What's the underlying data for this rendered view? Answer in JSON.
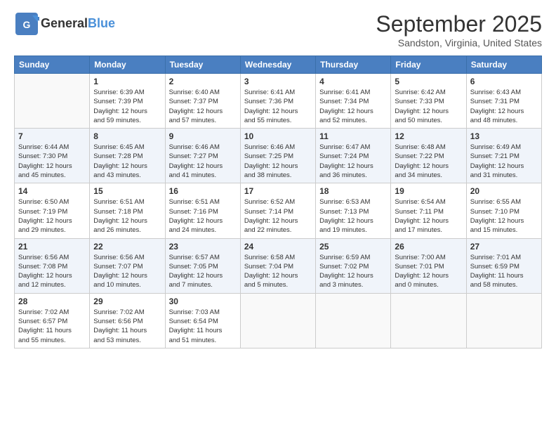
{
  "logo": {
    "general": "General",
    "blue": "Blue"
  },
  "header": {
    "month": "September 2025",
    "location": "Sandston, Virginia, United States"
  },
  "weekdays": [
    "Sunday",
    "Monday",
    "Tuesday",
    "Wednesday",
    "Thursday",
    "Friday",
    "Saturday"
  ],
  "weeks": [
    [
      {
        "day": "",
        "info": ""
      },
      {
        "day": "1",
        "info": "Sunrise: 6:39 AM\nSunset: 7:39 PM\nDaylight: 12 hours\nand 59 minutes."
      },
      {
        "day": "2",
        "info": "Sunrise: 6:40 AM\nSunset: 7:37 PM\nDaylight: 12 hours\nand 57 minutes."
      },
      {
        "day": "3",
        "info": "Sunrise: 6:41 AM\nSunset: 7:36 PM\nDaylight: 12 hours\nand 55 minutes."
      },
      {
        "day": "4",
        "info": "Sunrise: 6:41 AM\nSunset: 7:34 PM\nDaylight: 12 hours\nand 52 minutes."
      },
      {
        "day": "5",
        "info": "Sunrise: 6:42 AM\nSunset: 7:33 PM\nDaylight: 12 hours\nand 50 minutes."
      },
      {
        "day": "6",
        "info": "Sunrise: 6:43 AM\nSunset: 7:31 PM\nDaylight: 12 hours\nand 48 minutes."
      }
    ],
    [
      {
        "day": "7",
        "info": "Sunrise: 6:44 AM\nSunset: 7:30 PM\nDaylight: 12 hours\nand 45 minutes."
      },
      {
        "day": "8",
        "info": "Sunrise: 6:45 AM\nSunset: 7:28 PM\nDaylight: 12 hours\nand 43 minutes."
      },
      {
        "day": "9",
        "info": "Sunrise: 6:46 AM\nSunset: 7:27 PM\nDaylight: 12 hours\nand 41 minutes."
      },
      {
        "day": "10",
        "info": "Sunrise: 6:46 AM\nSunset: 7:25 PM\nDaylight: 12 hours\nand 38 minutes."
      },
      {
        "day": "11",
        "info": "Sunrise: 6:47 AM\nSunset: 7:24 PM\nDaylight: 12 hours\nand 36 minutes."
      },
      {
        "day": "12",
        "info": "Sunrise: 6:48 AM\nSunset: 7:22 PM\nDaylight: 12 hours\nand 34 minutes."
      },
      {
        "day": "13",
        "info": "Sunrise: 6:49 AM\nSunset: 7:21 PM\nDaylight: 12 hours\nand 31 minutes."
      }
    ],
    [
      {
        "day": "14",
        "info": "Sunrise: 6:50 AM\nSunset: 7:19 PM\nDaylight: 12 hours\nand 29 minutes."
      },
      {
        "day": "15",
        "info": "Sunrise: 6:51 AM\nSunset: 7:18 PM\nDaylight: 12 hours\nand 26 minutes."
      },
      {
        "day": "16",
        "info": "Sunrise: 6:51 AM\nSunset: 7:16 PM\nDaylight: 12 hours\nand 24 minutes."
      },
      {
        "day": "17",
        "info": "Sunrise: 6:52 AM\nSunset: 7:14 PM\nDaylight: 12 hours\nand 22 minutes."
      },
      {
        "day": "18",
        "info": "Sunrise: 6:53 AM\nSunset: 7:13 PM\nDaylight: 12 hours\nand 19 minutes."
      },
      {
        "day": "19",
        "info": "Sunrise: 6:54 AM\nSunset: 7:11 PM\nDaylight: 12 hours\nand 17 minutes."
      },
      {
        "day": "20",
        "info": "Sunrise: 6:55 AM\nSunset: 7:10 PM\nDaylight: 12 hours\nand 15 minutes."
      }
    ],
    [
      {
        "day": "21",
        "info": "Sunrise: 6:56 AM\nSunset: 7:08 PM\nDaylight: 12 hours\nand 12 minutes."
      },
      {
        "day": "22",
        "info": "Sunrise: 6:56 AM\nSunset: 7:07 PM\nDaylight: 12 hours\nand 10 minutes."
      },
      {
        "day": "23",
        "info": "Sunrise: 6:57 AM\nSunset: 7:05 PM\nDaylight: 12 hours\nand 7 minutes."
      },
      {
        "day": "24",
        "info": "Sunrise: 6:58 AM\nSunset: 7:04 PM\nDaylight: 12 hours\nand 5 minutes."
      },
      {
        "day": "25",
        "info": "Sunrise: 6:59 AM\nSunset: 7:02 PM\nDaylight: 12 hours\nand 3 minutes."
      },
      {
        "day": "26",
        "info": "Sunrise: 7:00 AM\nSunset: 7:01 PM\nDaylight: 12 hours\nand 0 minutes."
      },
      {
        "day": "27",
        "info": "Sunrise: 7:01 AM\nSunset: 6:59 PM\nDaylight: 11 hours\nand 58 minutes."
      }
    ],
    [
      {
        "day": "28",
        "info": "Sunrise: 7:02 AM\nSunset: 6:57 PM\nDaylight: 11 hours\nand 55 minutes."
      },
      {
        "day": "29",
        "info": "Sunrise: 7:02 AM\nSunset: 6:56 PM\nDaylight: 11 hours\nand 53 minutes."
      },
      {
        "day": "30",
        "info": "Sunrise: 7:03 AM\nSunset: 6:54 PM\nDaylight: 11 hours\nand 51 minutes."
      },
      {
        "day": "",
        "info": ""
      },
      {
        "day": "",
        "info": ""
      },
      {
        "day": "",
        "info": ""
      },
      {
        "day": "",
        "info": ""
      }
    ]
  ]
}
